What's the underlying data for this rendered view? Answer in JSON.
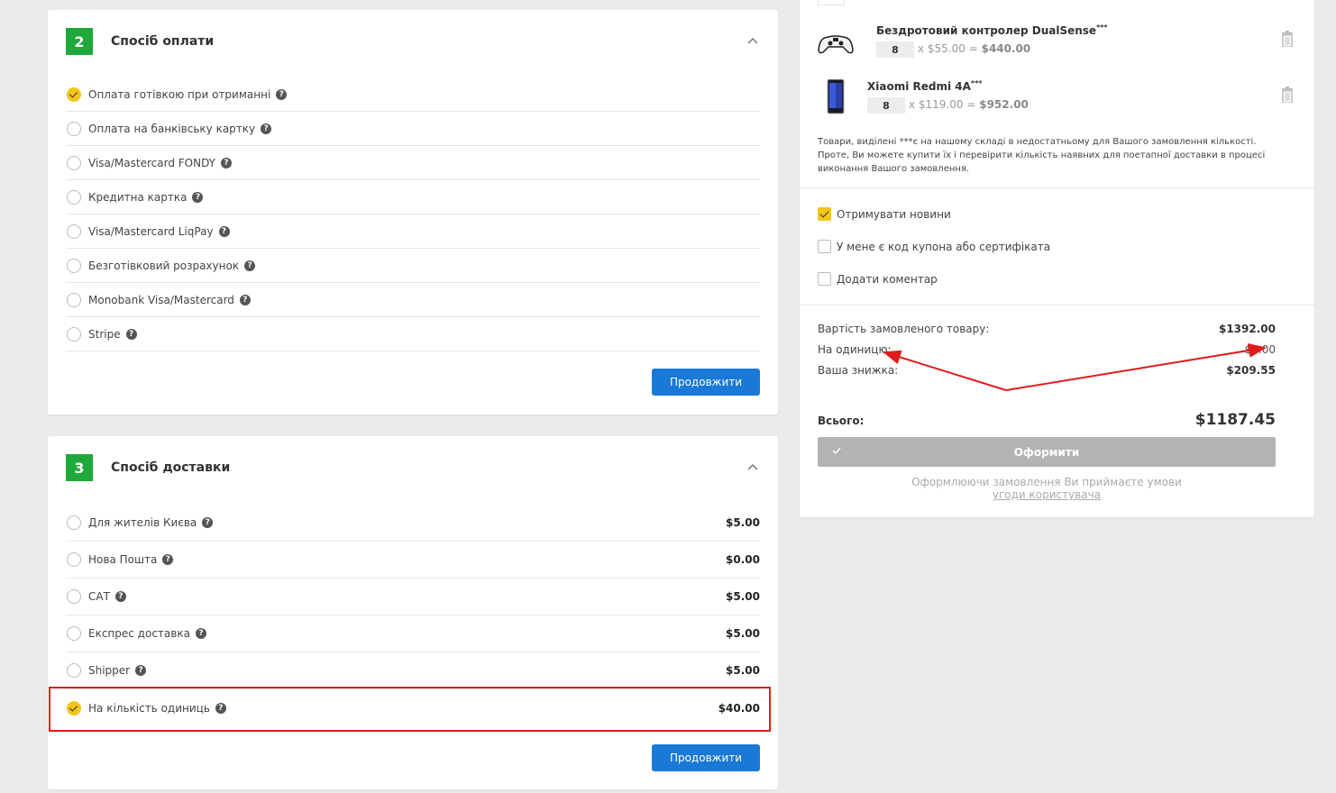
{
  "payment": {
    "step": "2",
    "title": "Спосіб оплати",
    "options": [
      {
        "label": "Оплата готівкою при отриманні",
        "selected": true
      },
      {
        "label": "Оплата на банківську картку",
        "selected": false
      },
      {
        "label": "Visa/Mastercard FONDY",
        "selected": false
      },
      {
        "label": "Кредитна картка",
        "selected": false
      },
      {
        "label": "Visa/Mastercard LiqPay",
        "selected": false
      },
      {
        "label": "Безготівковий розрахунок",
        "selected": false
      },
      {
        "label": "Monobank Visa/Mastercard",
        "selected": false
      },
      {
        "label": "Stripe",
        "selected": false
      }
    ],
    "continue_label": "Продовжити"
  },
  "delivery": {
    "step": "3",
    "title": "Спосіб доставки",
    "options": [
      {
        "label": "Для жителів Києва",
        "price": "$5.00",
        "selected": false
      },
      {
        "label": "Нова Пошта",
        "price": "$0.00",
        "selected": false
      },
      {
        "label": "САТ",
        "price": "$5.00",
        "selected": false
      },
      {
        "label": "Експрес доставка",
        "price": "$5.00",
        "selected": false
      },
      {
        "label": "Shipper",
        "price": "$5.00",
        "selected": false
      },
      {
        "label": "На кількість одиниць",
        "price": "$40.00",
        "selected": true
      }
    ],
    "continue_label": "Продовжити"
  },
  "cart": {
    "items": [
      {
        "name": "Бездротовий контролер DualSense",
        "mark": "***",
        "qty": "8",
        "unit_price": "x $55.00 = ",
        "line_total": "$440.00",
        "icon": "gamepad-icon"
      },
      {
        "name": "Xiaomi Redmi 4A",
        "mark": "***",
        "qty": "8",
        "unit_price": "x $119.00 = ",
        "line_total": "$952.00",
        "icon": "smartphone-icon"
      }
    ],
    "stock_note": "Товари, виділені ***є на нашому складі в недостатньому для Вашого замовлення кількості. Проте, Ви можете купити їх і перевірити кількість наявних для поетапної доставки в процесі виконання Вашого замовлення."
  },
  "options": {
    "news": {
      "label": "Отримувати новини",
      "checked": true
    },
    "coupon": {
      "label": "У мене є код купона або сертифіката",
      "checked": false
    },
    "comment": {
      "label": "Додати коментар",
      "checked": false
    }
  },
  "summary": {
    "goods_label": "Вартість замовленого товару:",
    "goods_value": "$1392.00",
    "per_unit_label": "На одиницю:",
    "per_unit_value": "$5.00",
    "discount_label": "Ваша знижка:",
    "discount_value": "$209.55",
    "total_label": "Всього:",
    "total_value": "$1187.45",
    "checkout_label": "Оформити",
    "terms_text": "Оформлюючи замовлення Ви приймаєте умови",
    "terms_link": "угоди користувача"
  },
  "colors": {
    "accent_green": "#1fa93c",
    "button_blue": "#1a78d6",
    "selected_yellow": "#f3c61a",
    "annotation_red": "#e01c1c"
  }
}
